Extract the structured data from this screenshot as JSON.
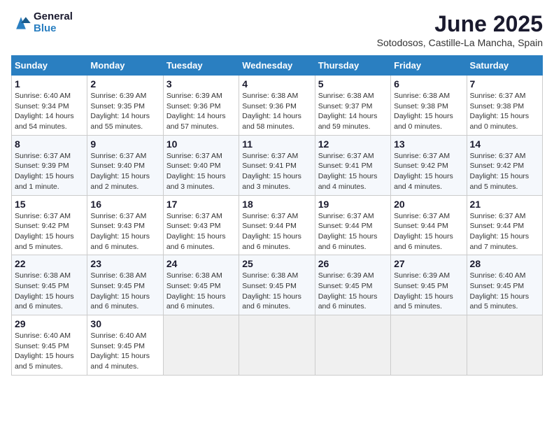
{
  "header": {
    "logo_line1": "General",
    "logo_line2": "Blue",
    "title": "June 2025",
    "subtitle": "Sotodosos, Castille-La Mancha, Spain"
  },
  "calendar": {
    "weekdays": [
      "Sunday",
      "Monday",
      "Tuesday",
      "Wednesday",
      "Thursday",
      "Friday",
      "Saturday"
    ],
    "weeks": [
      [
        {
          "day": "1",
          "info": "Sunrise: 6:40 AM\nSunset: 9:34 PM\nDaylight: 14 hours\nand 54 minutes."
        },
        {
          "day": "2",
          "info": "Sunrise: 6:39 AM\nSunset: 9:35 PM\nDaylight: 14 hours\nand 55 minutes."
        },
        {
          "day": "3",
          "info": "Sunrise: 6:39 AM\nSunset: 9:36 PM\nDaylight: 14 hours\nand 57 minutes."
        },
        {
          "day": "4",
          "info": "Sunrise: 6:38 AM\nSunset: 9:36 PM\nDaylight: 14 hours\nand 58 minutes."
        },
        {
          "day": "5",
          "info": "Sunrise: 6:38 AM\nSunset: 9:37 PM\nDaylight: 14 hours\nand 59 minutes."
        },
        {
          "day": "6",
          "info": "Sunrise: 6:38 AM\nSunset: 9:38 PM\nDaylight: 15 hours\nand 0 minutes."
        },
        {
          "day": "7",
          "info": "Sunrise: 6:37 AM\nSunset: 9:38 PM\nDaylight: 15 hours\nand 0 minutes."
        }
      ],
      [
        {
          "day": "8",
          "info": "Sunrise: 6:37 AM\nSunset: 9:39 PM\nDaylight: 15 hours\nand 1 minute."
        },
        {
          "day": "9",
          "info": "Sunrise: 6:37 AM\nSunset: 9:40 PM\nDaylight: 15 hours\nand 2 minutes."
        },
        {
          "day": "10",
          "info": "Sunrise: 6:37 AM\nSunset: 9:40 PM\nDaylight: 15 hours\nand 3 minutes."
        },
        {
          "day": "11",
          "info": "Sunrise: 6:37 AM\nSunset: 9:41 PM\nDaylight: 15 hours\nand 3 minutes."
        },
        {
          "day": "12",
          "info": "Sunrise: 6:37 AM\nSunset: 9:41 PM\nDaylight: 15 hours\nand 4 minutes."
        },
        {
          "day": "13",
          "info": "Sunrise: 6:37 AM\nSunset: 9:42 PM\nDaylight: 15 hours\nand 4 minutes."
        },
        {
          "day": "14",
          "info": "Sunrise: 6:37 AM\nSunset: 9:42 PM\nDaylight: 15 hours\nand 5 minutes."
        }
      ],
      [
        {
          "day": "15",
          "info": "Sunrise: 6:37 AM\nSunset: 9:42 PM\nDaylight: 15 hours\nand 5 minutes."
        },
        {
          "day": "16",
          "info": "Sunrise: 6:37 AM\nSunset: 9:43 PM\nDaylight: 15 hours\nand 6 minutes."
        },
        {
          "day": "17",
          "info": "Sunrise: 6:37 AM\nSunset: 9:43 PM\nDaylight: 15 hours\nand 6 minutes."
        },
        {
          "day": "18",
          "info": "Sunrise: 6:37 AM\nSunset: 9:44 PM\nDaylight: 15 hours\nand 6 minutes."
        },
        {
          "day": "19",
          "info": "Sunrise: 6:37 AM\nSunset: 9:44 PM\nDaylight: 15 hours\nand 6 minutes."
        },
        {
          "day": "20",
          "info": "Sunrise: 6:37 AM\nSunset: 9:44 PM\nDaylight: 15 hours\nand 6 minutes."
        },
        {
          "day": "21",
          "info": "Sunrise: 6:37 AM\nSunset: 9:44 PM\nDaylight: 15 hours\nand 7 minutes."
        }
      ],
      [
        {
          "day": "22",
          "info": "Sunrise: 6:38 AM\nSunset: 9:45 PM\nDaylight: 15 hours\nand 6 minutes."
        },
        {
          "day": "23",
          "info": "Sunrise: 6:38 AM\nSunset: 9:45 PM\nDaylight: 15 hours\nand 6 minutes."
        },
        {
          "day": "24",
          "info": "Sunrise: 6:38 AM\nSunset: 9:45 PM\nDaylight: 15 hours\nand 6 minutes."
        },
        {
          "day": "25",
          "info": "Sunrise: 6:38 AM\nSunset: 9:45 PM\nDaylight: 15 hours\nand 6 minutes."
        },
        {
          "day": "26",
          "info": "Sunrise: 6:39 AM\nSunset: 9:45 PM\nDaylight: 15 hours\nand 6 minutes."
        },
        {
          "day": "27",
          "info": "Sunrise: 6:39 AM\nSunset: 9:45 PM\nDaylight: 15 hours\nand 5 minutes."
        },
        {
          "day": "28",
          "info": "Sunrise: 6:40 AM\nSunset: 9:45 PM\nDaylight: 15 hours\nand 5 minutes."
        }
      ],
      [
        {
          "day": "29",
          "info": "Sunrise: 6:40 AM\nSunset: 9:45 PM\nDaylight: 15 hours\nand 5 minutes."
        },
        {
          "day": "30",
          "info": "Sunrise: 6:40 AM\nSunset: 9:45 PM\nDaylight: 15 hours\nand 4 minutes."
        },
        null,
        null,
        null,
        null,
        null
      ]
    ]
  }
}
